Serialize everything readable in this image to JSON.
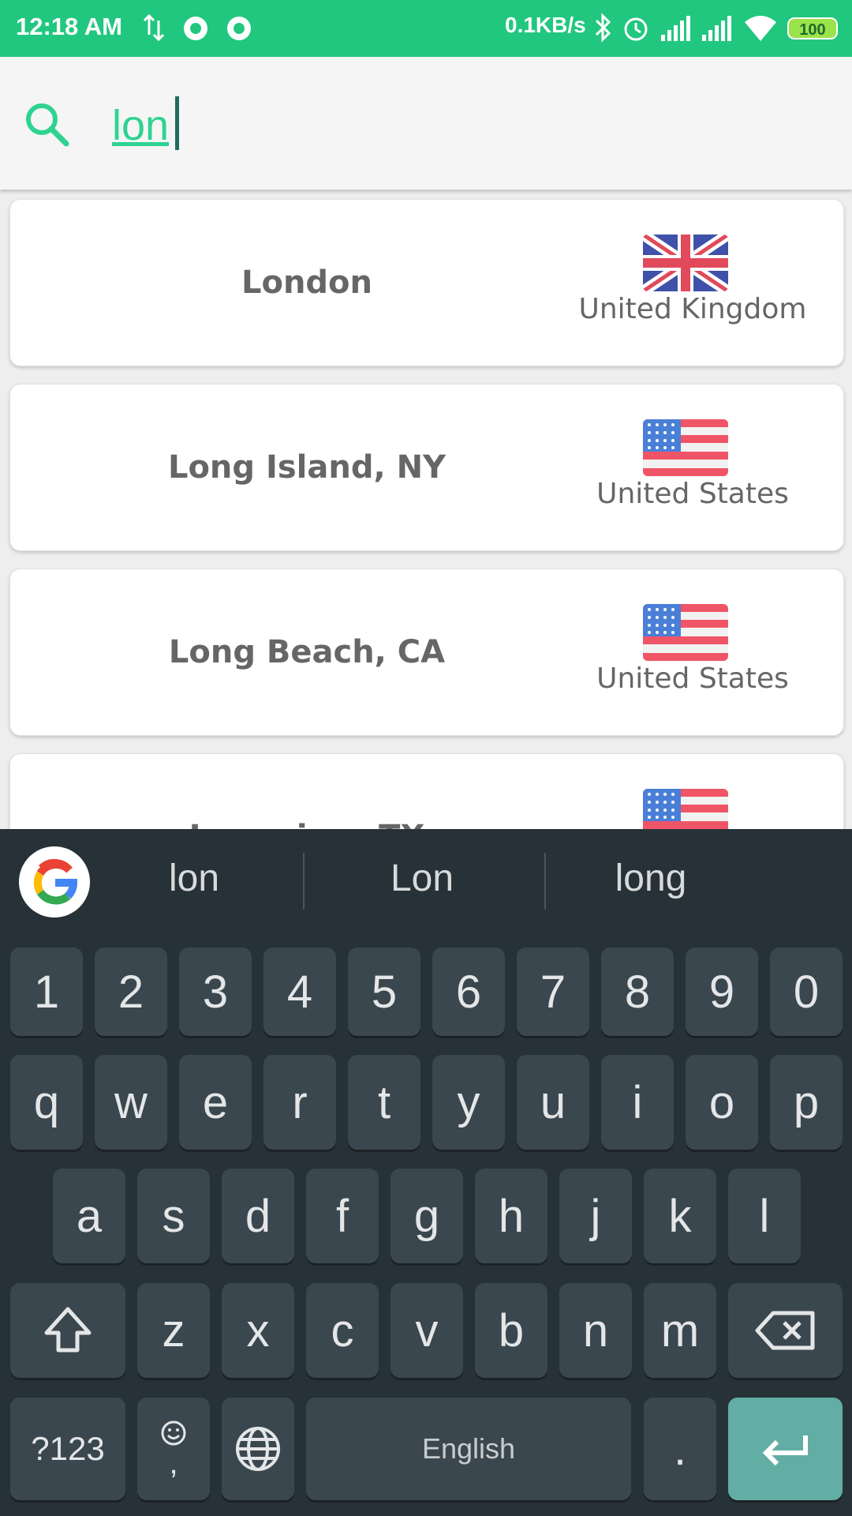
{
  "status_bar": {
    "time": "12:18 AM",
    "net_speed": "0.1KB/s",
    "battery": "100",
    "icons": [
      "data-transfer-icon",
      "record-icon",
      "record-icon",
      "bluetooth-icon",
      "alarm-icon",
      "signal-icon",
      "signal-icon",
      "wifi-icon",
      "battery-icon"
    ]
  },
  "search": {
    "value": "lon",
    "icon": "search-icon",
    "accent": "#2fd391"
  },
  "results": [
    {
      "city": "London",
      "country": "United Kingdom",
      "flag": "uk-flag-icon"
    },
    {
      "city": "Long Island, NY",
      "country": "United States",
      "flag": "us-flag-icon"
    },
    {
      "city": "Long Beach, CA",
      "country": "United States",
      "flag": "us-flag-icon"
    },
    {
      "city": "Longview, TX",
      "country": "",
      "flag": "us-flag-icon"
    }
  ],
  "keyboard": {
    "suggestions": [
      "lon",
      "Lon",
      "long"
    ],
    "row_numbers": [
      "1",
      "2",
      "3",
      "4",
      "5",
      "6",
      "7",
      "8",
      "9",
      "0"
    ],
    "row_top": [
      "q",
      "w",
      "e",
      "r",
      "t",
      "y",
      "u",
      "i",
      "o",
      "p"
    ],
    "row_middle": [
      "a",
      "s",
      "d",
      "f",
      "g",
      "h",
      "j",
      "k",
      "l"
    ],
    "row_bottom": [
      "z",
      "x",
      "c",
      "v",
      "b",
      "n",
      "m"
    ],
    "symbols_key": "?123",
    "comma_key": ",",
    "space_label": "English",
    "period_key": ".",
    "colors": {
      "background": "#263238",
      "key": "#3b474e",
      "enter": "#62aea4"
    }
  }
}
